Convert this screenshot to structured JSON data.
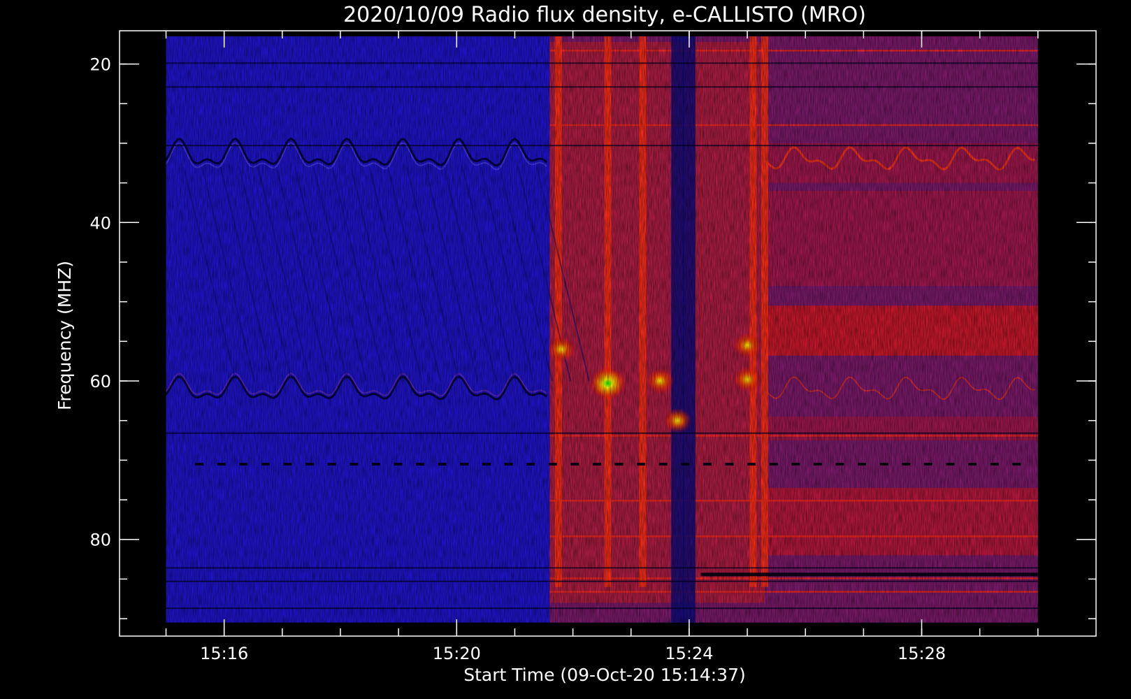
{
  "chart_data": {
    "type": "heatmap",
    "title": "2020/10/09  Radio flux density, e-CALLISTO (MRO)",
    "xlabel": "Start Time (09-Oct-20 15:14:37)",
    "ylabel": "Frequency (MHZ)",
    "x_unit": "minutes after 15:00 UT",
    "xlim": [
      14.2,
      31.0
    ],
    "ylim": [
      15.8,
      92.2
    ],
    "y_inverted": true,
    "x_data_range": [
      15.0,
      30.0
    ],
    "y_data_range": [
      16.5,
      90.5
    ],
    "x_major_ticks": [
      16,
      20,
      24,
      28
    ],
    "x_tick_labels": [
      "15:16",
      "15:20",
      "15:24",
      "15:28"
    ],
    "x_minor_ticks": [
      15,
      16,
      17,
      18,
      19,
      20,
      21,
      22,
      23,
      24,
      25,
      26,
      27,
      28,
      29,
      30
    ],
    "y_major_ticks": [
      20,
      40,
      60,
      80
    ],
    "y_tick_labels": [
      "20",
      "40",
      "60",
      "80"
    ],
    "y_minor_ticks": [
      20,
      25,
      30,
      35,
      40,
      45,
      50,
      55,
      60,
      65,
      70,
      75,
      80,
      85,
      90
    ],
    "colormap": [
      "#000000",
      "#0000ff",
      "#ff0000",
      "#ffff00",
      "#00ff00"
    ],
    "background_colors": {
      "quiet": "#1f14c8",
      "burst": "#7a1a6a"
    },
    "burst_onset_min": 21.6,
    "burst_end_min": 25.3,
    "bright_vertical_lanes_min": [
      21.75,
      22.6,
      23.2,
      25.1,
      25.3
    ],
    "dark_vertical_lanes_min": [
      23.8,
      24.0
    ],
    "bright_spots": [
      {
        "t": 22.6,
        "f": 60.3,
        "level": 3
      },
      {
        "t": 23.5,
        "f": 60.0,
        "level": 2
      },
      {
        "t": 25.0,
        "f": 59.8,
        "level": 2
      },
      {
        "t": 23.8,
        "f": 65.0,
        "level": 2
      },
      {
        "t": 21.8,
        "f": 56.0,
        "level": 2
      },
      {
        "t": 25.0,
        "f": 55.5,
        "level": 2
      }
    ]
  }
}
